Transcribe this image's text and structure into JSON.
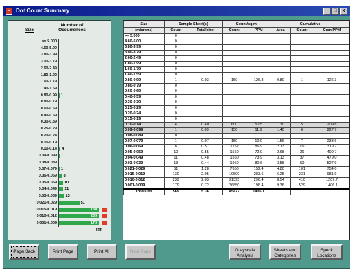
{
  "window": {
    "title": "Dot Count Summary",
    "controls": [
      "_",
      "□",
      "x"
    ]
  },
  "histogram": {
    "headers": {
      "size": "Size",
      "occurrences": "Number of Occurrences"
    },
    "rows": [
      {
        "size": ">= 5.000",
        "count": ""
      },
      {
        "size": "4.60-5.00",
        "count": ""
      },
      {
        "size": "3.80-3.99",
        "count": ""
      },
      {
        "size": "3.00-3.79",
        "count": ""
      },
      {
        "size": "2.60-2.49",
        "count": ""
      },
      {
        "size": "1.80-1.99",
        "count": ""
      },
      {
        "size": "1.60-1.79",
        "count": ""
      },
      {
        "size": "1.40-1.59",
        "count": ""
      },
      {
        "size": "0.80-0.99",
        "count": "1"
      },
      {
        "size": "0.80-0.79",
        "count": ""
      },
      {
        "size": "0.60-0.69",
        "count": ""
      },
      {
        "size": "0.40-0.59",
        "count": ""
      },
      {
        "size": "0.30-0.39",
        "count": ""
      },
      {
        "size": "0.25-0.29",
        "count": ""
      },
      {
        "size": "0.20-0.24",
        "count": ""
      },
      {
        "size": "0.15-0.19",
        "count": ""
      },
      {
        "size": "0.10-0.14",
        "count": "4"
      },
      {
        "size": "0.09-0.099",
        "count": "1"
      },
      {
        "size": "0.08-0.089",
        "count": ""
      },
      {
        "size": "0.07-0.079",
        "count": "1"
      },
      {
        "size": "0.06-0.069",
        "count": "8"
      },
      {
        "size": "0.05-0.059",
        "count": "10"
      },
      {
        "size": "0.04-0.049",
        "count": "11"
      },
      {
        "size": "0.03-0.039",
        "count": "13"
      },
      {
        "size": "0.021-0.029",
        "count": "51"
      },
      {
        "size": "0.015-0.019",
        "count": "130"
      },
      {
        "size": "0.010-0.012",
        "count": "239"
      },
      {
        "size": "0.001-0.009",
        "count": "179"
      }
    ],
    "bar_values": [
      0,
      0,
      0,
      0,
      0,
      0,
      0,
      0,
      1,
      0,
      0,
      0,
      0,
      0,
      0,
      0,
      4,
      1,
      0,
      1,
      8,
      10,
      11,
      13,
      51,
      130,
      239,
      179
    ],
    "scale_max": 100,
    "over_scale_color": "#e53a2a",
    "bar_color": "#2ea84a",
    "total": "100"
  },
  "table": {
    "group_headers": [
      "Size",
      "Sample Sheet(s)",
      "Count/sq.m.",
      "— Cumulative —"
    ],
    "columns": [
      "(microns)",
      "Count",
      "Total/size",
      "Count",
      "PPM",
      "Area",
      "Count",
      "Cum.PPM"
    ],
    "rows": [
      [
        ">= 5.000",
        "0",
        "",
        "",
        "",
        "",
        "",
        ""
      ],
      [
        "4.60-5.00",
        "0",
        "",
        "",
        "",
        "",
        "",
        ""
      ],
      [
        "3.80-3.99",
        "0",
        "",
        "",
        "",
        "",
        "",
        ""
      ],
      [
        "3.00-3.79",
        "0",
        "",
        "",
        "",
        "",
        "",
        ""
      ],
      [
        "2.60-2.49",
        "0",
        "",
        "",
        "",
        "",
        "",
        ""
      ],
      [
        "1.80-1.99",
        "0",
        "",
        "",
        "",
        "",
        "",
        ""
      ],
      [
        "1.60-1.79",
        "0",
        "",
        "",
        "",
        "",
        "",
        ""
      ],
      [
        "1.40-1.59",
        "0",
        "",
        "",
        "",
        "",
        "",
        ""
      ],
      [
        "0.80-0.99",
        "1",
        "0.03",
        "150",
        "126.3",
        "0.80",
        "1",
        "126.3"
      ],
      [
        "0.80-0.79",
        "0",
        "",
        "",
        "",
        "",
        "",
        ""
      ],
      [
        "0.60-0.69",
        "0",
        "",
        "",
        "",
        "",
        "",
        ""
      ],
      [
        "0.40-0.59",
        "0",
        "",
        "",
        "",
        "",
        "",
        ""
      ],
      [
        "0.30-0.39",
        "0",
        "",
        "",
        "",
        "",
        "",
        ""
      ],
      [
        "0.25-0.29",
        "0",
        "",
        "",
        "",
        "",
        "",
        ""
      ],
      [
        "0.20-0.24",
        "0",
        "",
        "",
        "",
        "",
        "",
        ""
      ],
      [
        "0.15-0.19",
        "0",
        "",
        "",
        "",
        "",
        "",
        ""
      ],
      [
        "0.10-0.14",
        "4",
        "0.40",
        "600",
        "50.5",
        "1.30",
        "5",
        "209.8"
      ],
      [
        "0.09-0.099",
        "1",
        "0.09",
        "150",
        "11.9",
        "1.40",
        "6",
        "227.7"
      ],
      [
        "0.08-0.089",
        "0",
        "",
        "",
        "",
        "",
        "",
        ""
      ],
      [
        "0.07-0.079",
        "1",
        "0.07",
        "150",
        "10.9",
        "1.56",
        "7",
        "233.6"
      ],
      [
        "0.06-0.069",
        "8",
        "0.57",
        "1252",
        "86.9",
        "2.13",
        "16",
        "319.7"
      ],
      [
        "0.05-0.059",
        "10",
        "0.55",
        "1560",
        "72.9",
        "2.68",
        "26",
        "409.7"
      ],
      [
        "0.04-0.049",
        "11",
        "0.48",
        "1560",
        "73.9",
        "3.13",
        "37",
        "479.0"
      ],
      [
        "0.03-0.039",
        "13",
        "0.44",
        "1950",
        "80.6",
        "3.58",
        "50",
        "527.9"
      ],
      [
        "0.021-0.029",
        "51",
        "1.28",
        "7650",
        "152.4",
        "4.80",
        "101",
        "754.0"
      ],
      [
        "0.015-0.019",
        "130",
        "2.05",
        "19500",
        "283.6",
        "6.25",
        "231",
        "981.9"
      ],
      [
        "0.010-0.012",
        "239",
        "2.03",
        "31395",
        "296.4",
        "8.54",
        "410",
        "1207.7"
      ],
      [
        "0.001-0.009",
        "179",
        "0.72",
        "26850",
        "198.4",
        "9.36",
        "529",
        "1406.1"
      ]
    ],
    "selected_rows": [
      16,
      17
    ],
    "totals": [
      "Totals =>",
      "569",
      "5.36",
      "85477",
      "1406.1",
      "",
      "",
      ""
    ]
  },
  "buttons": [
    {
      "id": "page-back",
      "label": "Page Back",
      "state": "focused"
    },
    {
      "id": "print-page",
      "label": "Print Page",
      "state": "normal"
    },
    {
      "id": "print-all",
      "label": "Print All",
      "state": "normal"
    },
    {
      "id": "next-page",
      "label": "Next Page",
      "state": "disabled"
    },
    {
      "id": "grayscale-analysis",
      "label": "Grayscale Analysis",
      "state": "normal"
    },
    {
      "id": "sheets-categories",
      "label": "Sheets and Categories",
      "state": "normal"
    },
    {
      "id": "speck-locations",
      "label": "Speck Locations",
      "state": "normal"
    }
  ]
}
